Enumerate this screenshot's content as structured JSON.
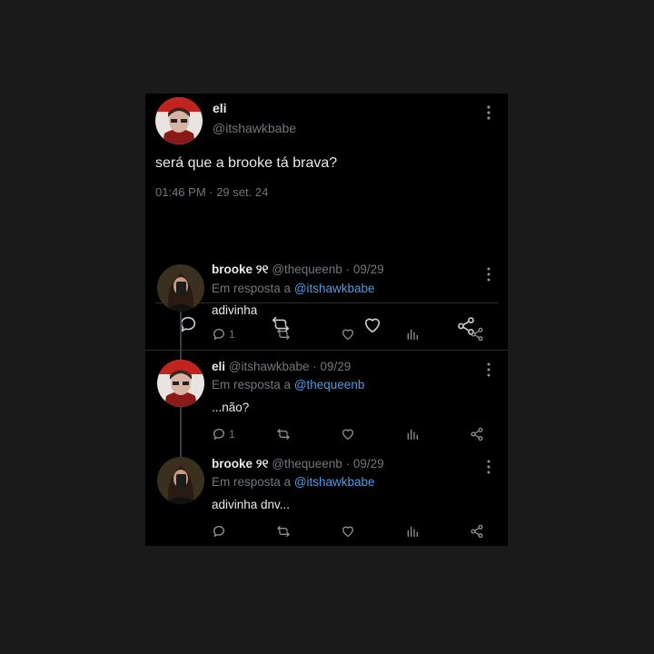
{
  "colors": {
    "background": "#1a1a1a",
    "card": "#000000",
    "text": "#e7e9ea",
    "muted": "#71767b",
    "link": "#4f9ae6"
  },
  "main_tweet": {
    "name": "eli",
    "handle": "@itshawkbabe",
    "text": "será que a brooke tá brava?",
    "timestamp": "01:46 PM · 29 set. 24",
    "actions": [
      "reply-icon",
      "retweet-icon",
      "like-icon",
      "share-icon"
    ]
  },
  "replies": [
    {
      "name": "brooke",
      "name_suffix": "୨୧",
      "handle_date": "@thequeenb · 09/29",
      "reply_prefix": "Em resposta a",
      "reply_to": "@itshawkbabe",
      "text": "adivinha",
      "reply_count": "1"
    },
    {
      "name": "eli",
      "name_suffix": "",
      "handle_date": "@itshawkbabe · 09/29",
      "reply_prefix": "Em resposta a",
      "reply_to": "@thequeenb",
      "text": "...não?",
      "reply_count": "1"
    },
    {
      "name": "brooke",
      "name_suffix": "୨୧",
      "handle_date": "@thequeenb · 09/29",
      "reply_prefix": "Em resposta a",
      "reply_to": "@itshawkbabe",
      "text": "adivinha dnv...",
      "reply_count": ""
    }
  ]
}
